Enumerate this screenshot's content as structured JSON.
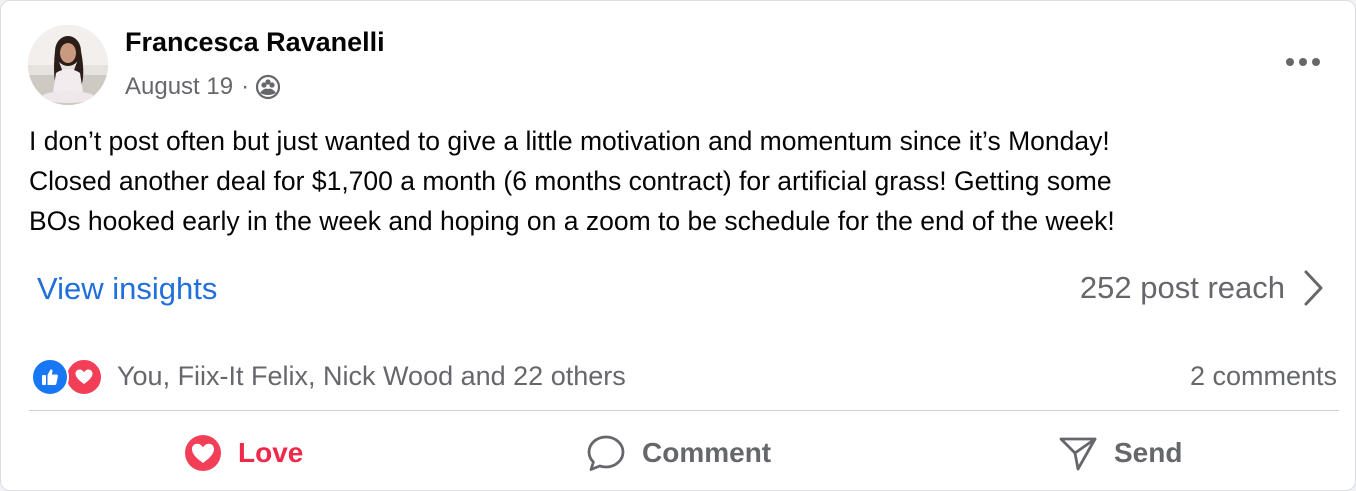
{
  "post": {
    "author": "Francesca Ravanelli",
    "date": "August 19",
    "separator": "·",
    "audience_icon": "friends-audience-icon",
    "more_icon": "more-options-icon",
    "text_lines": [
      "I don’t post often but just wanted to give a little motivation and momentum since it’s Monday!",
      "Closed another deal for $1,700 a month (6 months contract) for artificial grass! Getting some",
      "BOs hooked early in the week and hoping on a zoom to be schedule for the end of the week!"
    ]
  },
  "insights": {
    "view_label": "View insights",
    "reach_label": "252 post reach"
  },
  "reactions": {
    "icons": [
      "like-reaction-icon",
      "love-reaction-icon"
    ],
    "summary": "You, Fiix-It Felix, Nick Wood and 22 others",
    "comments": "2 comments"
  },
  "actions": {
    "love": "Love",
    "comment": "Comment",
    "send": "Send"
  },
  "colors": {
    "accent_blue": "#216fdb",
    "love_red": "#f02849",
    "secondary_text": "#65676b",
    "like_blue": "#1877f2"
  }
}
